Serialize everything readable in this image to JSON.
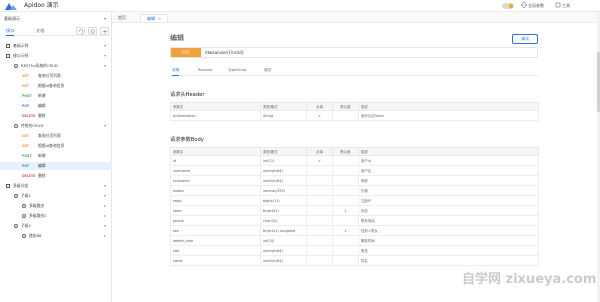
{
  "app": {
    "title": "Apidoo 演示",
    "brand_color": "#2f6fd6"
  },
  "topbar": {
    "links": [
      {
        "label": "全局参数",
        "icon": "globe-icon"
      },
      {
        "label": "工具",
        "icon": "tools-icon"
      }
    ]
  },
  "sidebar": {
    "project": "基础演示",
    "tabs": [
      "接口",
      "文档"
    ],
    "tree": [
      {
        "label": "基础示例",
        "indent": 0,
        "type": "folder",
        "toggle": "▾",
        "sel": false
      },
      {
        "label": "接口示例",
        "indent": 0,
        "type": "folder",
        "toggle": "▾",
        "sel": false
      },
      {
        "label": "RESTful风格的CRUD",
        "indent": 1,
        "type": "group",
        "toggle": "▾",
        "sel": false
      },
      {
        "verb": "GET",
        "label": "查询分页列表",
        "indent": 2,
        "type": "api",
        "sel": false
      },
      {
        "verb": "GET",
        "label": "根据id查询信息",
        "indent": 2,
        "type": "api",
        "sel": false
      },
      {
        "verb": "POST",
        "label": "新增",
        "indent": 2,
        "type": "api",
        "sel": false
      },
      {
        "verb": "PUT",
        "label": "编辑",
        "indent": 2,
        "type": "api",
        "sel": false
      },
      {
        "verb": "DELETE",
        "label": "删除",
        "indent": 2,
        "type": "api",
        "sel": false
      },
      {
        "label": "传统的CRUD",
        "indent": 1,
        "type": "group",
        "toggle": "▾",
        "sel": false
      },
      {
        "verb": "GET",
        "label": "查询分页列表",
        "indent": 2,
        "type": "api",
        "sel": false
      },
      {
        "verb": "GET",
        "label": "根据id查询信息",
        "indent": 2,
        "type": "api",
        "sel": false
      },
      {
        "verb": "POST",
        "label": "新增",
        "indent": 2,
        "type": "api",
        "sel": false
      },
      {
        "verb": "PUT",
        "label": "编辑",
        "indent": 2,
        "type": "api",
        "sel": true
      },
      {
        "verb": "DELETE",
        "label": "删除",
        "indent": 2,
        "type": "api",
        "sel": false
      },
      {
        "label": "多级分组",
        "indent": 0,
        "type": "folder",
        "toggle": "▾",
        "sel": false
      },
      {
        "label": "子级1",
        "indent": 1,
        "type": "group",
        "toggle": "▾",
        "sel": false
      },
      {
        "label": "多级路由",
        "indent": 2,
        "type": "group",
        "toggle": "▸",
        "sel": false
      },
      {
        "label": "多级路由2",
        "indent": 2,
        "type": "group",
        "toggle": "▸",
        "sel": false
      },
      {
        "label": "子级2",
        "indent": 1,
        "type": "group",
        "toggle": "▾",
        "sel": false
      },
      {
        "label": "路由88",
        "indent": 2,
        "type": "group",
        "toggle": "▸",
        "sel": false
      }
    ]
  },
  "tabs": [
    {
      "label": "首页",
      "active": false
    },
    {
      "label": "编辑",
      "active": true,
      "close": "×"
    }
  ],
  "main": {
    "title": "编辑",
    "run_label": "调试",
    "method": "PUT",
    "url": "/dwaa/user/{inclid}",
    "subtabs": [
      "说明",
      "Request",
      "TypeScript",
      "调试"
    ],
    "header_section": "请求头Header",
    "body_section": "请求参数Body",
    "columns": [
      "参数名",
      "类型/格式",
      "必填",
      "默认值",
      "描述"
    ],
    "header_rows": [
      [
        "Authorization",
        "String",
        "✔",
        "",
        "身份认证Token"
      ]
    ],
    "body_rows": [
      [
        "id",
        "int(11)",
        "✔",
        "",
        "用户id"
      ],
      [
        "username",
        "varchar(64)",
        "",
        "",
        "用户名"
      ],
      [
        "nickname",
        "varchar(64)",
        "",
        "",
        "昵称"
      ],
      [
        "avatar",
        "varchar(255)",
        "",
        "",
        "头像"
      ],
      [
        "regip",
        "bigint(11)",
        "",
        "",
        "注册IP"
      ],
      [
        "state",
        "tinyint(1)",
        "",
        "1",
        "状态"
      ],
      [
        "phone",
        "char(32)",
        "",
        "",
        "联系电话"
      ],
      [
        "sex",
        "tinyint(1) unsigned",
        "",
        "1",
        "性别:1男女"
      ],
      [
        "delete_time",
        "int(10)",
        "",
        "",
        "删除时间"
      ],
      [
        "role",
        "varchar(64)",
        "",
        "",
        "角色"
      ],
      [
        "name",
        "varchar(64)",
        "",
        "",
        "姓名"
      ]
    ]
  },
  "watermark": "自学网 zixueya.com"
}
